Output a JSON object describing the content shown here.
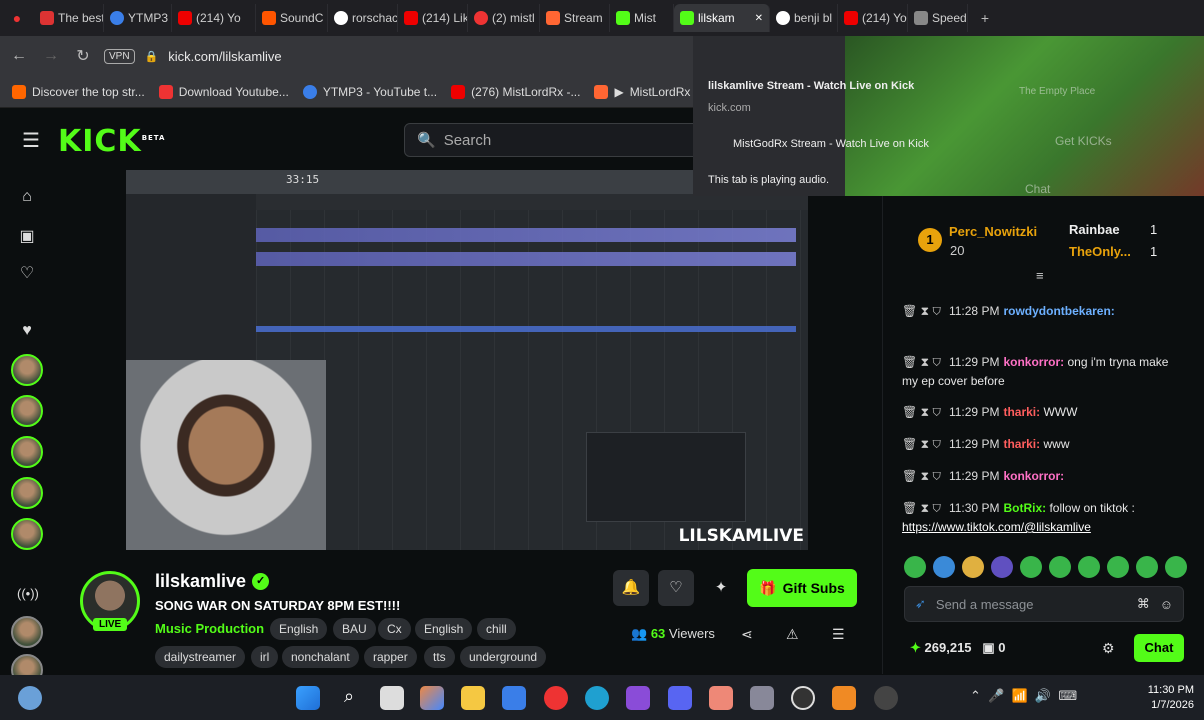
{
  "tabs": [
    {
      "label": "The best"
    },
    {
      "label": "YTMP3"
    },
    {
      "label": "(214) Yo"
    },
    {
      "label": "SoundC"
    },
    {
      "label": "rorschac"
    },
    {
      "label": "(214) Lik"
    },
    {
      "label": "(2) mistl"
    },
    {
      "label": "Stream"
    },
    {
      "label": "Mist"
    },
    {
      "label": "lilskam"
    },
    {
      "label": "benji bl"
    },
    {
      "label": "(214) Yo"
    },
    {
      "label": "Speed C"
    }
  ],
  "address": {
    "vpn": "VPN",
    "url": "kick.com/lilskamlive"
  },
  "bookmarks": [
    {
      "label": "Discover the top str..."
    },
    {
      "label": "Download Youtube..."
    },
    {
      "label": "YTMP3 - YouTube t..."
    },
    {
      "label": "(276) MistLordRx -..."
    },
    {
      "label": "MistLordRx idek..."
    }
  ],
  "popup": {
    "title": "lilskamlive Stream - Watch Live on Kick",
    "domain": "kick.com",
    "other": "MistGodRx Stream - Watch Live on Kick",
    "audio": "This tab is playing audio.",
    "overlay_1": "Get KICKs",
    "overlay_2": "Chat",
    "overlay_3": "The Empty Place"
  },
  "header": {
    "logo": "KICK",
    "logo_sup": "BETA",
    "search_placeholder": "Search"
  },
  "video": {
    "watermark": "LILSKAMLIVE",
    "daw_time": "33:15"
  },
  "channel": {
    "name": "lilskamlive",
    "live": "LIVE",
    "title": "SONG WAR ON SATURDAY 8PM EST!!!!",
    "category": "Music Production",
    "tags_row1": [
      "English",
      "BAU",
      "Cx",
      "English",
      "chill"
    ],
    "tags_row2": [
      "dailystreamer",
      "irl",
      "nonchalant",
      "rapper",
      "tts",
      "underground"
    ],
    "gift_subs": "Gift Subs",
    "viewers": "63",
    "viewers_label": "Viewers"
  },
  "chat": {
    "pinned": [
      {
        "user": "Perc_Nowitzki",
        "count": "20",
        "rank": "1"
      },
      {
        "user": "Rainbae",
        "count": "1"
      },
      {
        "user": "TheOnly...",
        "count": "1"
      }
    ],
    "messages": [
      {
        "time": "11:28 PM",
        "user": "rowdydontbekaren:",
        "text": ""
      },
      {
        "time": "11:29 PM",
        "user": "konkorror:",
        "text": "ong i'm tryna make my ep cover before"
      },
      {
        "time": "11:29 PM",
        "user": "tharki:",
        "text": "WWW"
      },
      {
        "time": "11:29 PM",
        "user": "tharki:",
        "text": "www"
      },
      {
        "time": "11:29 PM",
        "user": "konkorror:",
        "text": ""
      },
      {
        "time": "11:30 PM",
        "user": "BotRix:",
        "text": "follow on tiktok :",
        "link": "https://www.tiktok.com/@lilskamlive"
      }
    ],
    "input_placeholder": "Send a message",
    "points": "269,215",
    "drops": "0",
    "chat_button": "Chat"
  },
  "taskbar": {
    "time": "11:30 PM",
    "date": "1/7/2026"
  }
}
